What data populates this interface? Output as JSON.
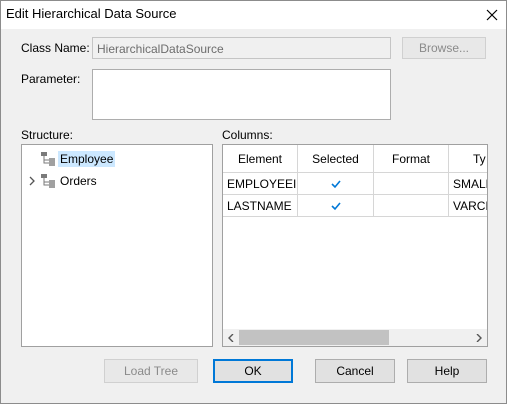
{
  "window": {
    "title": "Edit Hierarchical Data Source"
  },
  "class_name": {
    "label": "Class Name:",
    "value": "HierarchicalDataSource",
    "browse_label": "Browse..."
  },
  "parameter": {
    "label": "Parameter:",
    "value": ""
  },
  "structure": {
    "label": "Structure:",
    "items": [
      {
        "label": "Employee",
        "selected": true,
        "expandable": false
      },
      {
        "label": "Orders",
        "selected": false,
        "expandable": true
      }
    ]
  },
  "columns": {
    "label": "Columns:",
    "headers": [
      "Element",
      "Selected",
      "Format",
      "Ty"
    ],
    "rows": [
      {
        "element": "EMPLOYEEID",
        "selected": true,
        "format": "",
        "type": "SMALLI"
      },
      {
        "element": "LASTNAME",
        "selected": true,
        "format": "",
        "type": "VARCH"
      }
    ]
  },
  "buttons": {
    "load_tree": "Load Tree",
    "ok": "OK",
    "cancel": "Cancel",
    "help": "Help"
  },
  "colors": {
    "accent": "#0078d7",
    "selection": "#cce8ff",
    "check": "#0078d7"
  },
  "icons": {
    "close": "close-icon",
    "node": "hierarchy-node-icon",
    "expand": "chevron-right-icon",
    "check": "checkmark-icon"
  }
}
